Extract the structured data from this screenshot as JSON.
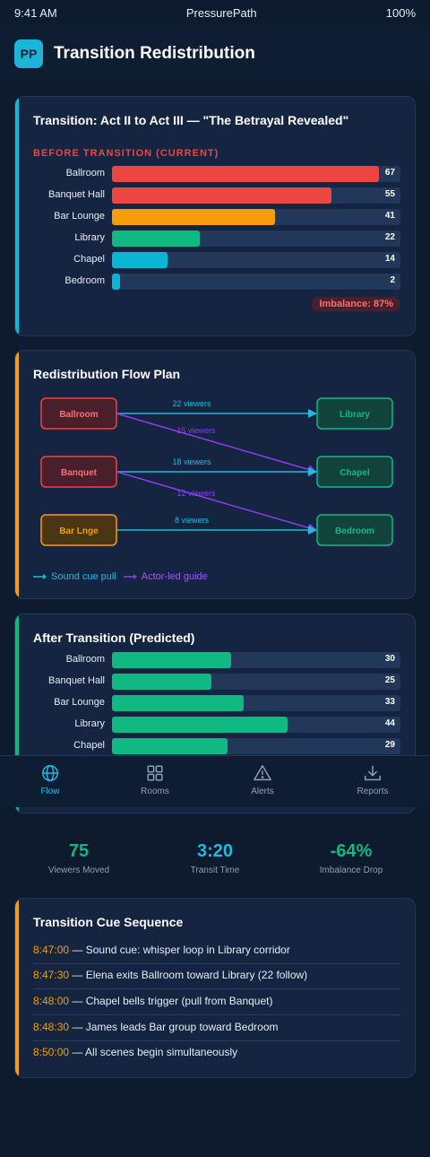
{
  "status_bar": {
    "time": "9:41 AM",
    "app_name": "PressurePath",
    "battery": "100%"
  },
  "header": {
    "logo_text": "PP",
    "title": "Transition Redistribution"
  },
  "before_card": {
    "title": "Transition: Act II to Act III — \"The Betrayal Revealed\"",
    "section_label": "BEFORE TRANSITION (CURRENT)",
    "max": 67,
    "rooms": [
      {
        "name": "Ballroom",
        "value": 67,
        "color": "#ef4444"
      },
      {
        "name": "Banquet Hall",
        "value": 55,
        "color": "#ef4444"
      },
      {
        "name": "Bar Lounge",
        "value": 41,
        "color": "#f59e0b"
      },
      {
        "name": "Library",
        "value": 22,
        "color": "#10b981"
      },
      {
        "name": "Chapel",
        "value": 14,
        "color": "#06b6d4"
      },
      {
        "name": "Bedroom",
        "value": 2,
        "color": "#06b6d4"
      }
    ],
    "imbalance": "Imbalance: 87%"
  },
  "flow_card": {
    "title": "Redistribution Flow Plan",
    "sources": [
      "Ballroom",
      "Banquet",
      "Bar Lnge"
    ],
    "targets": [
      "Library",
      "Chapel",
      "Bedroom"
    ],
    "flows": [
      {
        "label": "22 viewers",
        "type": "sound"
      },
      {
        "label": "15 viewers",
        "type": "actor"
      },
      {
        "label": "18 viewers",
        "type": "sound"
      },
      {
        "label": "12 viewers",
        "type": "actor"
      },
      {
        "label": "8 viewers",
        "type": "sound"
      }
    ],
    "legend": {
      "sound": "Sound cue pull",
      "actor": "Actor-led guide"
    },
    "colors": {
      "sound": "#22b8e0",
      "actor": "#8b3cf0"
    }
  },
  "after_card": {
    "title": "After Transition (Predicted)",
    "max": 67,
    "color": "#10b981",
    "rooms": [
      {
        "name": "Ballroom",
        "value": 30
      },
      {
        "name": "Banquet Hall",
        "value": 25
      },
      {
        "name": "Bar Lounge",
        "value": 33
      },
      {
        "name": "Library",
        "value": 44
      },
      {
        "name": "Chapel",
        "value": 29
      }
    ]
  },
  "tabs": [
    {
      "label": "Flow",
      "icon": "globe-icon",
      "active": true
    },
    {
      "label": "Rooms",
      "icon": "grid-icon",
      "active": false
    },
    {
      "label": "Alerts",
      "icon": "alert-triangle-icon",
      "active": false
    },
    {
      "label": "Reports",
      "icon": "download-icon",
      "active": false
    }
  ],
  "stats": [
    {
      "value": "75",
      "label": "Viewers Moved",
      "color": "#10b981"
    },
    {
      "value": "3:20",
      "label": "Transit Time",
      "color": "#22b8e0"
    },
    {
      "value": "-64%",
      "label": "Imbalance Drop",
      "color": "#10b981"
    }
  ],
  "cue_card": {
    "title": "Transition Cue Sequence",
    "cues": [
      {
        "time": "8:47:00",
        "text": " — Sound cue: whisper loop in Library corridor"
      },
      {
        "time": "8:47:30",
        "text": " — Elena exits Ballroom toward Library (22 follow)"
      },
      {
        "time": "8:48:00",
        "text": " — Chapel bells trigger (pull from Banquet)"
      },
      {
        "time": "8:48:30",
        "text": " — James leads Bar group toward Bedroom"
      },
      {
        "time": "8:50:00",
        "text": " — All scenes begin simultaneously"
      }
    ]
  }
}
